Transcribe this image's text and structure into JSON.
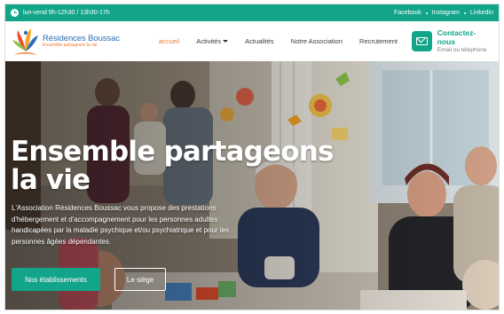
{
  "topbar": {
    "hours": "lun-vend 9h-12h30 / 13h30-17h",
    "social": [
      "Facebook",
      "Instagram",
      "Linkedin"
    ],
    "icon": "clock-icon"
  },
  "header": {
    "logo_name": "Résidences Boussac",
    "logo_tagline": "Ensemble partageons la vie",
    "nav": {
      "accueil": "accueil",
      "activites": "Activités",
      "actualites": "Actualités",
      "association": "Notre Association",
      "recrutement": "Recrutement"
    },
    "contact_title": "Contactez-nous",
    "contact_sub": "Email ou téléphone",
    "contact_icon": "mail-icon"
  },
  "hero": {
    "title_line1": "Ensemble partageons",
    "title_line2": "la vie",
    "description": "L'Association Résidences Boussac vous propose des prestations d'hébergement et d'accompagnement pour les personnes adultes handicapées par la maladie psychique et/ou psychiatrique et pour les personnes âgées dépendantes.",
    "btn_primary": "Nos établissements",
    "btn_secondary": "Le siège"
  },
  "colors": {
    "brand_green": "#12a58a",
    "accent_orange": "#ef7d2c",
    "brand_blue": "#2b6fb7"
  }
}
